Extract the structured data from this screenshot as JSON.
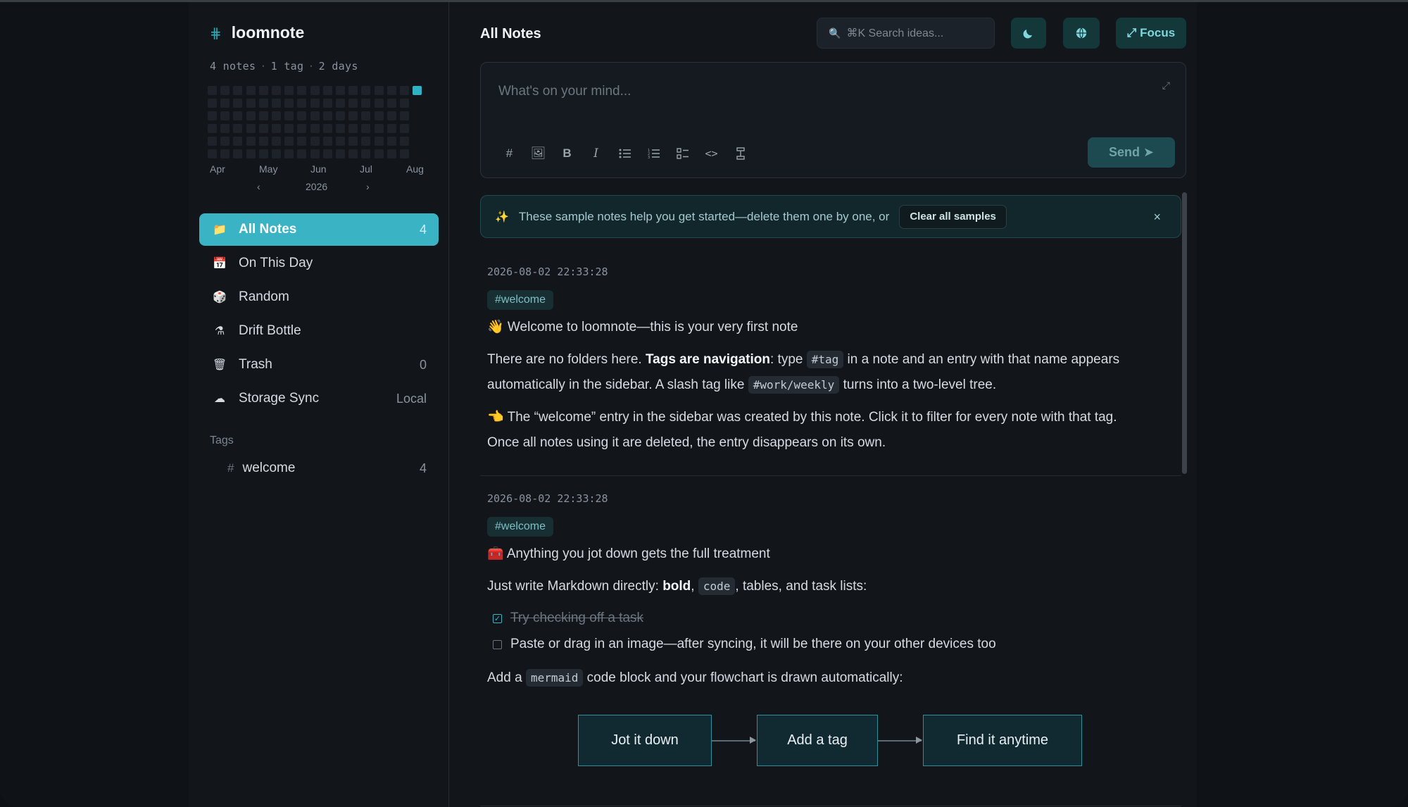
{
  "app": {
    "name": "loomnote",
    "stats": [
      "4 notes",
      "1 tag",
      "2 days"
    ]
  },
  "heatmap": {
    "months": [
      "Apr",
      "May",
      "Jun",
      "Jul",
      "Aug"
    ],
    "year": "2026",
    "prev_icon": "‹",
    "next_icon": "›",
    "active_color": "#2fb3c2"
  },
  "sidebar": {
    "items": [
      {
        "label": "All Notes",
        "count": "4",
        "icon": "folder-icon",
        "glyph": "📁"
      },
      {
        "label": "On This Day",
        "count": "",
        "icon": "calendar-icon",
        "glyph": "📅"
      },
      {
        "label": "Random",
        "count": "",
        "icon": "dice-icon",
        "glyph": "🎲"
      },
      {
        "label": "Drift Bottle",
        "count": "",
        "icon": "bottle-icon",
        "glyph": "⚗"
      },
      {
        "label": "Trash",
        "count": "0",
        "icon": "trash-icon",
        "glyph": "🗑"
      },
      {
        "label": "Storage Sync",
        "count": "Local",
        "icon": "cloud-icon",
        "glyph": "☁"
      }
    ],
    "tags_title": "Tags",
    "tags": [
      {
        "label": "welcome",
        "count": "4"
      }
    ]
  },
  "header": {
    "title": "All Notes",
    "search_placeholder": "⌘K Search ideas...",
    "focus_label": "⤢ Focus"
  },
  "composer": {
    "placeholder": "What's on your mind...",
    "send_label": "Send ➤"
  },
  "banner": {
    "text": "These sample notes help you get started—delete them one by one, or",
    "clear_label": "Clear all samples",
    "close": "×"
  },
  "notes": [
    {
      "timestamp": "2026-08-02 22:33:28",
      "tag": "#welcome",
      "heading": "👋 Welcome to loomnote—this is your very first note",
      "p1_a": "There are no folders here. ",
      "p1_b": "Tags are navigation",
      "p1_c": ": type ",
      "p1_code1": "#tag",
      "p1_d": " in a note and an entry with that name appears",
      "p1_e": "automatically in the sidebar. A slash tag like ",
      "p1_code2": "#work/weekly",
      "p1_f": " turns into a two-level tree.",
      "p2_a": "👈 The “welcome” entry in the sidebar was created by this note. Click it to filter for every note with that tag.",
      "p2_b": "Once all notes using it are deleted, the entry disappears on its own."
    },
    {
      "timestamp": "2026-08-02 22:33:28",
      "tag": "#welcome",
      "heading": "🧰 Anything you jot down gets the full treatment",
      "p1_a": "Just write Markdown directly: ",
      "p1_b": "bold",
      "p1_c": ", ",
      "p1_code": "code",
      "p1_d": ", tables, and task lists:",
      "task1": "Try checking off a task",
      "task1_done": true,
      "task2": "Paste or drag in an image—after syncing, it will be there on your other devices too",
      "task2_done": false,
      "p2_a": "Add a ",
      "p2_code": "mermaid",
      "p2_b": " code block and your flowchart is drawn automatically:",
      "flow": [
        "Jot it down",
        "Add a tag",
        "Find it anytime"
      ]
    }
  ]
}
